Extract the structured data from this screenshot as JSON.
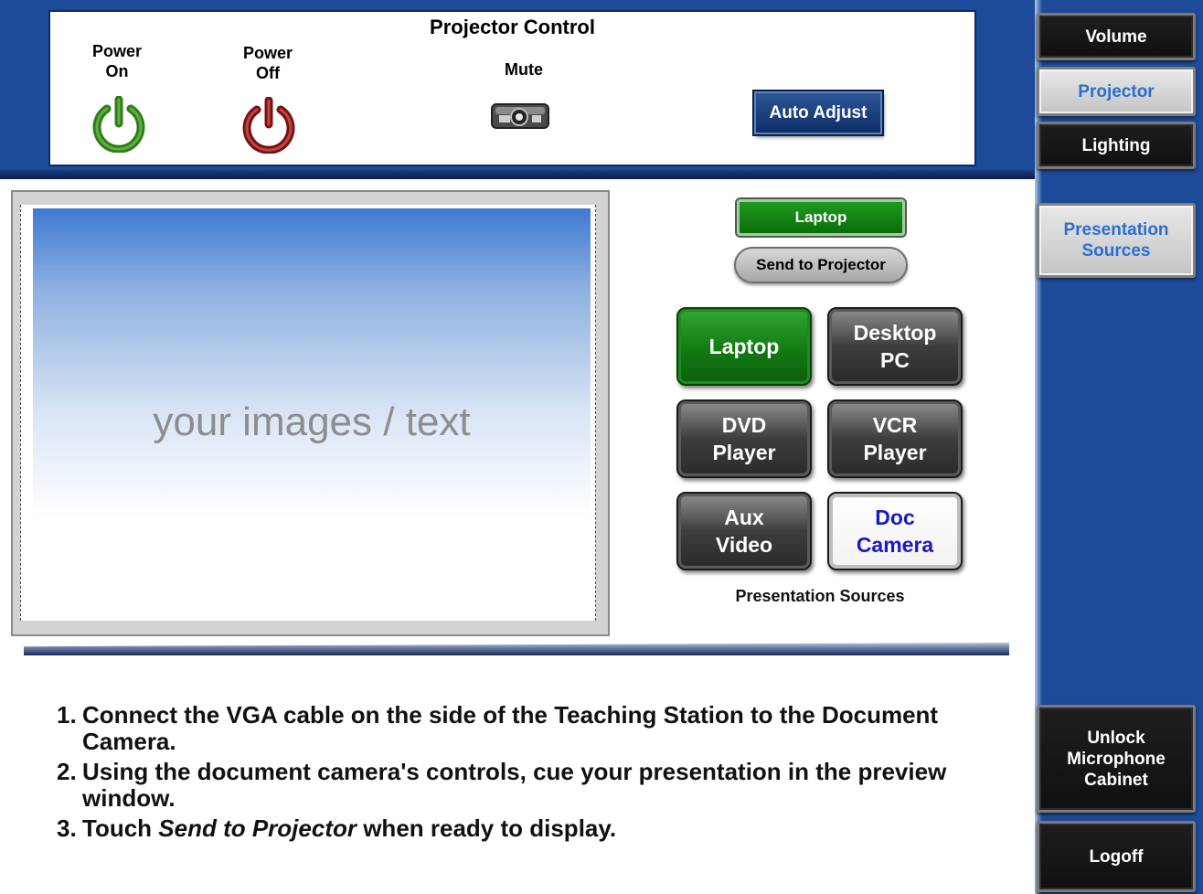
{
  "projector_panel": {
    "title": "Projector Control",
    "power_on_label": "Power\nOn",
    "power_off_label": "Power\nOff",
    "mute_label": "Mute",
    "auto_adjust_label": "Auto Adjust",
    "power_on_color": "#2e7d1a",
    "power_off_color": "#7a1010"
  },
  "sidebar": {
    "volume": "Volume",
    "projector": "Projector",
    "lighting": "Lighting",
    "presentation_sources": "Presentation Sources",
    "unlock_microphone": "Unlock Microphone Cabinet",
    "logoff": "Logoff"
  },
  "preview": {
    "placeholder_text": "your images / text"
  },
  "source_control": {
    "current_source": "Laptop",
    "send_to_projector": "Send to Projector",
    "caption": "Presentation Sources",
    "buttons": [
      {
        "label": "Laptop",
        "state": "active"
      },
      {
        "label": "Desktop PC",
        "state": "normal"
      },
      {
        "label": "DVD Player",
        "state": "normal"
      },
      {
        "label": "VCR Player",
        "state": "normal"
      },
      {
        "label": "Aux Video",
        "state": "normal"
      },
      {
        "label": "Doc Camera",
        "state": "highlight"
      }
    ]
  },
  "instructions": [
    {
      "num": "1.",
      "text": "Connect the VGA cable on the side of the Teaching Station to the Document Camera."
    },
    {
      "num": "2.",
      "text": "Using the document camera's controls, cue your presentation in the preview window."
    },
    {
      "num": "3.",
      "before": "Touch ",
      "emphasis": "Send to Projector",
      "after": " when ready to display."
    }
  ],
  "colors": {
    "header_blue": "#1d4b9a",
    "active_green": "#127a12",
    "highlight_text": "#1919c8",
    "selected_sidebar_text": "#2a6fd0"
  }
}
